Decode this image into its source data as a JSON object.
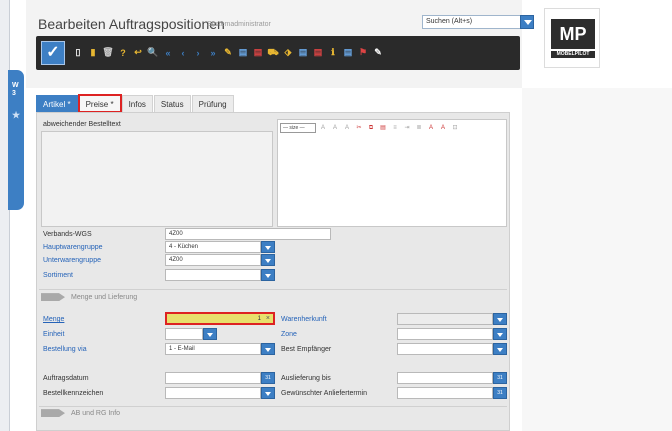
{
  "side": {
    "tab_label_top": "W\n3",
    "tab_star": "★"
  },
  "header": {
    "title": "Bearbeiten Auftragspositionen",
    "subtitle": "Systemadministrator",
    "search_placeholder": "Suchen (Alt+s)"
  },
  "logo": {
    "mark": "MP",
    "name": "MÖBELPILOT"
  },
  "toolbar": {
    "confirm_glyph": "✓",
    "icons": [
      {
        "name": "new-doc-icon",
        "glyph": "▯",
        "color": "#f4f4f4"
      },
      {
        "name": "save-icon",
        "glyph": "▮",
        "color": "#e8b732"
      },
      {
        "name": "delete-icon",
        "glyph": "🗑",
        "color": "#cfcfcf"
      },
      {
        "name": "help-icon",
        "glyph": "?",
        "color": "#e8b732"
      },
      {
        "name": "back-icon",
        "glyph": "↩",
        "color": "#e8b732"
      },
      {
        "name": "search-icon",
        "glyph": "🔍",
        "color": "#3d7fc4"
      },
      {
        "name": "first-icon",
        "glyph": "«",
        "color": "#3d7fc4"
      },
      {
        "name": "prev-icon",
        "glyph": "‹",
        "color": "#3d7fc4"
      },
      {
        "name": "next-icon",
        "glyph": "›",
        "color": "#3d7fc4"
      },
      {
        "name": "last-icon",
        "glyph": "»",
        "color": "#3d7fc4"
      },
      {
        "name": "attach-icon",
        "glyph": "✎",
        "color": "#e8b732"
      },
      {
        "name": "doc-blue-icon",
        "glyph": "▤",
        "color": "#6aa7e6"
      },
      {
        "name": "doc-red-icon",
        "glyph": "▤",
        "color": "#d44"
      },
      {
        "name": "truck-icon",
        "glyph": "⛟",
        "color": "#e8b732"
      },
      {
        "name": "tag-icon",
        "glyph": "⬗",
        "color": "#e8b732"
      },
      {
        "name": "doc-check-icon",
        "glyph": "▤",
        "color": "#6aa7e6"
      },
      {
        "name": "list-icon",
        "glyph": "▤",
        "color": "#d44"
      },
      {
        "name": "info-doc-icon",
        "glyph": "ℹ",
        "color": "#e8b732"
      },
      {
        "name": "doc-arrow-icon",
        "glyph": "▤",
        "color": "#6aa7e6"
      },
      {
        "name": "flag-icon",
        "glyph": "⚑",
        "color": "#d44"
      },
      {
        "name": "edit-icon",
        "glyph": "✎",
        "color": "#f4f4f4"
      }
    ]
  },
  "tabs": [
    {
      "label": "Artikel *",
      "state": "active"
    },
    {
      "label": "Preise *",
      "state": "marked"
    },
    {
      "label": "Infos",
      "state": "normal"
    },
    {
      "label": "Status",
      "state": "normal"
    },
    {
      "label": "Prüfung",
      "state": "normal"
    }
  ],
  "article": {
    "abweichender_label": "abweichender Bestelltext",
    "rte_select": "— size —",
    "verbands_wgs_label": "Verbands-WGS",
    "verbands_wgs_value": "4Z00",
    "hauptwarengruppe_label": "Hauptwarengruppe",
    "hauptwarengruppe_value": "4 - Küchen",
    "unterwarengruppe_label": "Unterwarengruppe",
    "unterwarengruppe_value": "4Z00",
    "sortiment_label": "Sortiment",
    "sortiment_value": ""
  },
  "menge": {
    "section_title": "Menge und Lieferung",
    "menge_label": "Menge",
    "menge_value": "1",
    "menge_clear": "×",
    "einheit_label": "Einheit",
    "einheit_value": "",
    "bestellung_via_label": "Bestellung via",
    "bestellung_via_value": "1 - E-Mail",
    "warenherkunft_label": "Warenherkunft",
    "warenherkunft_value": "",
    "zone_label": "Zone",
    "zone_value": "",
    "best_empfaenger_label": "Best Empfänger",
    "best_empfaenger_value": "",
    "auftragsdatum_label": "Auftragsdatum",
    "auftragsdatum_value": "",
    "bestellkennzeichen_label": "Bestellkennzeichen",
    "bestellkennzeichen_value": "",
    "auslieferung_bis_label": "Auslieferung bis",
    "auslieferung_bis_value": "",
    "gewuenschter_label": "Gewünschter Anliefertermin",
    "gewuenschter_value": "",
    "cal_glyph": "31"
  },
  "ab_section": {
    "title": "AB und RG Info"
  }
}
